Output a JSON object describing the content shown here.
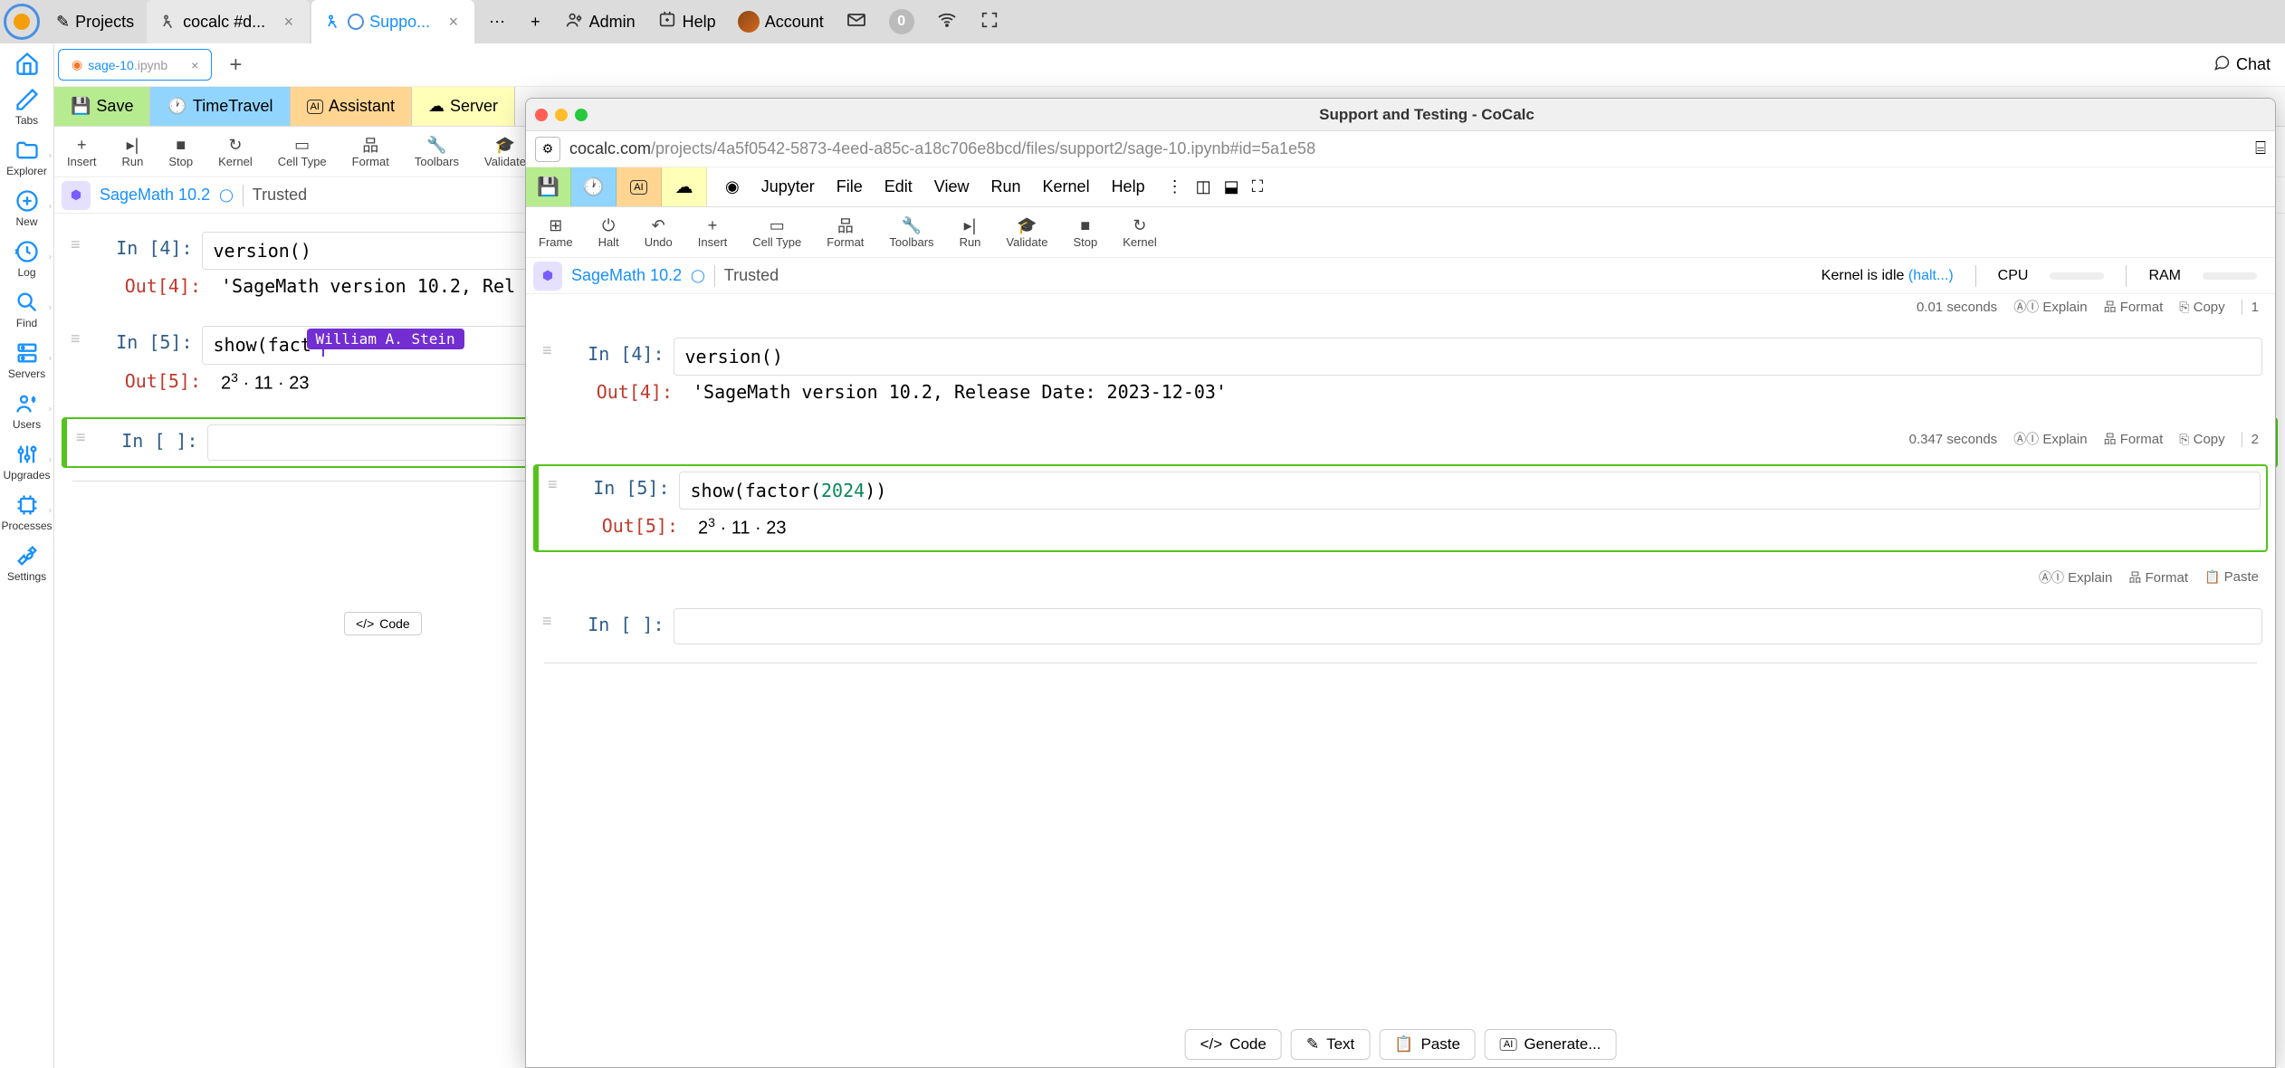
{
  "top_bar": {
    "projects_label": "Projects",
    "tabs": [
      {
        "label": "cocalc #d...",
        "icon": "running-icon"
      },
      {
        "label": "Suppo...",
        "icon": "running-icon",
        "active": true
      }
    ],
    "admin_label": "Admin",
    "help_label": "Help",
    "account_label": "Account",
    "notif_count": "0"
  },
  "sidebar": {
    "items": [
      {
        "icon": "home-icon",
        "label": ""
      },
      {
        "icon": "edit-icon",
        "label": "Tabs"
      },
      {
        "icon": "folder-icon",
        "label": "Explorer"
      },
      {
        "icon": "plus-circle-icon",
        "label": "New"
      },
      {
        "icon": "history-icon",
        "label": "Log"
      },
      {
        "icon": "search-icon",
        "label": "Find"
      },
      {
        "icon": "server-icon",
        "label": "Servers"
      },
      {
        "icon": "users-icon",
        "label": "Users"
      },
      {
        "icon": "sliders-icon",
        "label": "Upgrades"
      },
      {
        "icon": "chip-icon",
        "label": "Processes"
      },
      {
        "icon": "wrench-icon",
        "label": "Settings"
      }
    ]
  },
  "file_tabs": {
    "active": {
      "name": "sage-10",
      "ext": ".ipynb"
    },
    "chat_label": "Chat"
  },
  "action_bar": {
    "save": "Save",
    "timetravel": "TimeTravel",
    "assistant": "Assistant",
    "server": "Server"
  },
  "toolbar": {
    "items": [
      "Insert",
      "Run",
      "Stop",
      "Kernel",
      "Cell Type",
      "Format",
      "Toolbars",
      "Validate"
    ]
  },
  "kernel": {
    "name": "SageMath 10.2",
    "trusted": "Trusted"
  },
  "notebook_left": {
    "cells": [
      {
        "in_prompt": "In [4]:",
        "code": "version()",
        "out_prompt": "Out[4]:",
        "output": "'SageMath version 10.2, Rel"
      },
      {
        "in_prompt": "In [5]:",
        "code": "show(fact",
        "out_prompt": "Out[5]:",
        "output_math": "2³ · 11 · 23",
        "user_tag": "William A. Stein"
      },
      {
        "in_prompt": "In [ ]:",
        "code": ""
      }
    ],
    "code_btn": "Code"
  },
  "window2": {
    "title": "Support and Testing - CoCalc",
    "url_prefix": "cocalc.com",
    "url_path": "/projects/4a5f0542-5873-4eed-a85c-a18c706e8bcd/files/support2/sage-10.ipynb#id=5a1e58",
    "menu": {
      "jupyter": "Jupyter",
      "file": "File",
      "edit": "Edit",
      "view": "View",
      "run": "Run",
      "kernel": "Kernel",
      "help": "Help"
    },
    "toolbar": {
      "items": [
        "Frame",
        "Halt",
        "Undo",
        "Insert",
        "Cell Type",
        "Format",
        "Toolbars",
        "Run",
        "Validate",
        "Stop",
        "Kernel"
      ]
    },
    "kernel_row": {
      "name": "SageMath 10.2",
      "trusted": "Trusted",
      "status": "Kernel is idle",
      "halt_link": "(halt...)",
      "cpu_label": "CPU",
      "ram_label": "RAM"
    },
    "cells": [
      {
        "meta_time": "0.01 seconds",
        "meta_explain": "Explain",
        "meta_format": "Format",
        "meta_copy": "Copy",
        "meta_idx": "1",
        "in_prompt": "In [4]:",
        "code": "version()",
        "out_prompt": "Out[4]:",
        "output": "'SageMath version 10.2, Release Date: 2023-12-03'"
      },
      {
        "meta_time": "0.347 seconds",
        "meta_explain": "Explain",
        "meta_format": "Format",
        "meta_copy": "Copy",
        "meta_idx": "2",
        "in_prompt": "In [5]:",
        "code_pre": "show(factor(",
        "code_num": "2024",
        "code_post": "))",
        "out_prompt": "Out[5]:",
        "output_math": "2³ · 11 · 23",
        "selected": true
      },
      {
        "meta_explain": "Explain",
        "meta_format": "Format",
        "meta_paste": "Paste",
        "in_prompt": "In [ ]:",
        "code": ""
      }
    ],
    "bottom": {
      "code": "Code",
      "text": "Text",
      "paste": "Paste",
      "generate": "Generate..."
    }
  }
}
